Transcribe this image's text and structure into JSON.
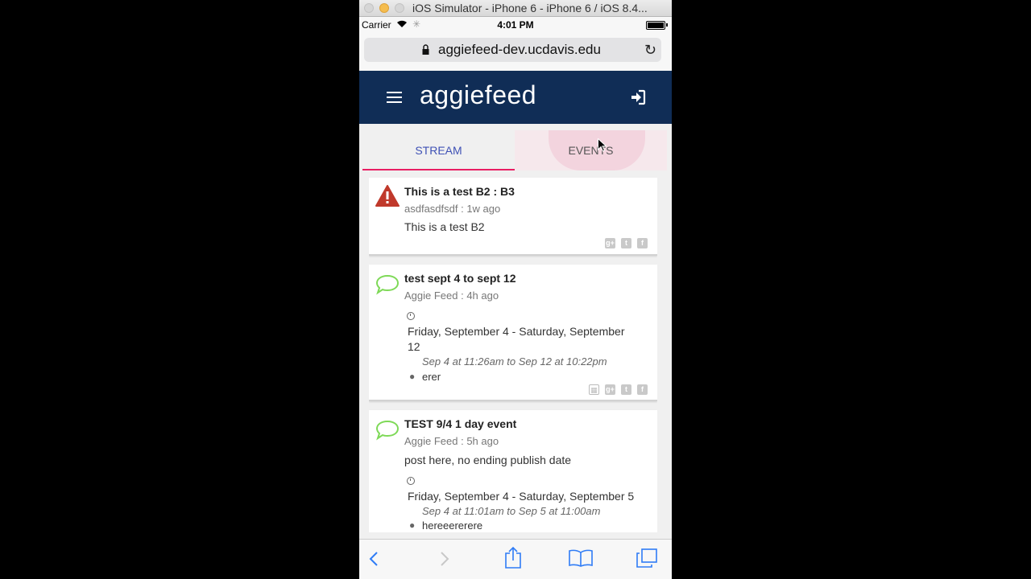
{
  "window": {
    "title": "iOS Simulator - iPhone 6 - iPhone 6 / iOS 8.4..."
  },
  "status_bar": {
    "carrier": "Carrier",
    "time": "4:01 PM"
  },
  "browser": {
    "url": "aggiefeed-dev.ucdavis.edu"
  },
  "app": {
    "brand": "aggiefeed",
    "accent": "#102d56"
  },
  "tabs": [
    {
      "label": "STREAM",
      "active": true
    },
    {
      "label": "EVENTS",
      "active": false
    }
  ],
  "feed": [
    {
      "icon": "warning-icon",
      "title": "This is a test B2 : B3",
      "meta": "asdfasdfsdf : 1w ago",
      "body": "This is a test B2"
    },
    {
      "icon": "speech-bubble-icon",
      "title": "test sept 4 to sept 12",
      "meta": "Aggie Feed : 4h ago",
      "date_line1": "Friday, September 4 - Saturday, September",
      "date_line2": "12",
      "time": "Sep 4 at 11:26am to Sep 12 at 10:22pm",
      "location": "erer"
    },
    {
      "icon": "speech-bubble-icon",
      "title": "TEST 9/4 1 day event",
      "meta": "Aggie Feed : 5h ago",
      "body": "post here, no ending publish date",
      "date_line1": "Friday, September 4 - Saturday, September 5",
      "time": "Sep 4 at 11:01am to Sep 5 at 11:00am",
      "location": "hereeererere"
    }
  ],
  "colors": {
    "warning": "#c0392b",
    "bubble": "#7ed957",
    "tab_active": "#3f51b5",
    "tab_indicator": "#e91e63",
    "ios_blue": "#2f7cf6"
  }
}
